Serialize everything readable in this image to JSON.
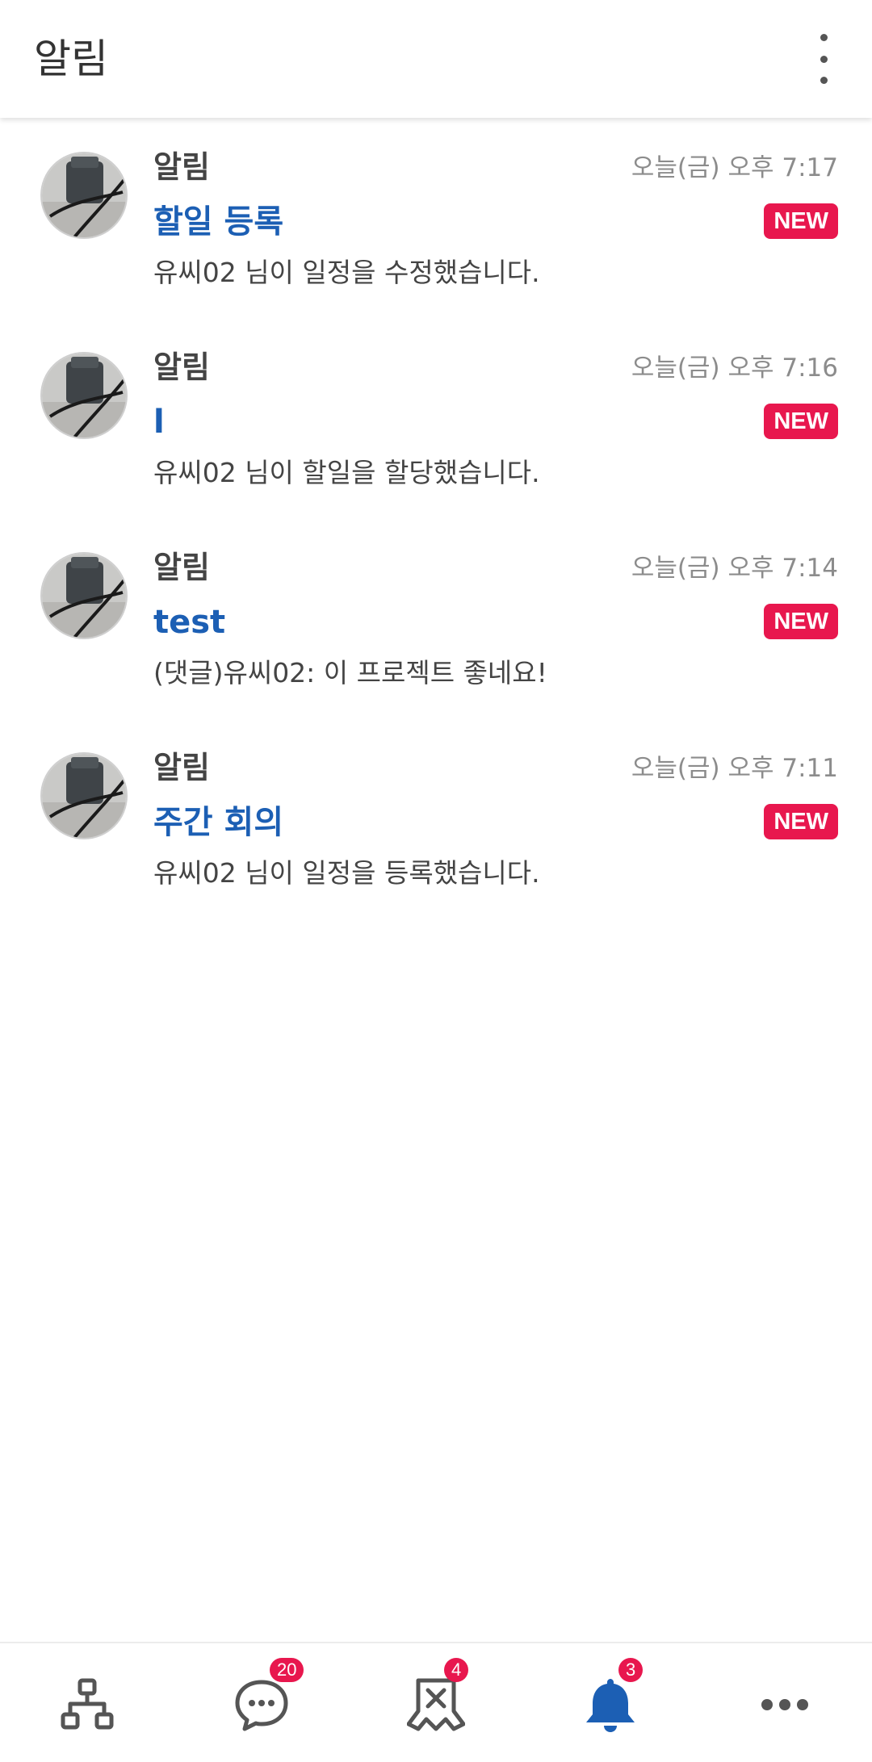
{
  "app_bar": {
    "title": "알림",
    "menu_icon": "more-vert-icon"
  },
  "notifications": [
    {
      "sender": "알림",
      "time": "오늘(금) 오후 7:17",
      "subject": "할일 등록",
      "badge": "NEW",
      "body": "유씨02 님이 일정을 수정했습니다."
    },
    {
      "sender": "알림",
      "time": "오늘(금) 오후 7:16",
      "subject": "l",
      "badge": "NEW",
      "body": "유씨02 님이 할일을 할당했습니다."
    },
    {
      "sender": "알림",
      "time": "오늘(금) 오후 7:14",
      "subject": "test",
      "badge": "NEW",
      "body": "(댓글)유씨02: 이 프로젝트 좋네요!"
    },
    {
      "sender": "알림",
      "time": "오늘(금) 오후 7:11",
      "subject": "주간 회의",
      "badge": "NEW",
      "body": "유씨02 님이 일정을 등록했습니다."
    }
  ],
  "tab_bar": {
    "tabs": [
      {
        "icon": "org-chart-icon",
        "badge": ""
      },
      {
        "icon": "chat-bubble-icon",
        "badge": "20"
      },
      {
        "icon": "task-x-icon",
        "badge": "4"
      },
      {
        "icon": "bell-icon",
        "badge": "3",
        "active": true
      },
      {
        "icon": "more-horiz-icon",
        "badge": ""
      }
    ]
  },
  "colors": {
    "accent": "#1c5fb4",
    "badge": "#e8174e",
    "icon_inactive": "#555555"
  }
}
